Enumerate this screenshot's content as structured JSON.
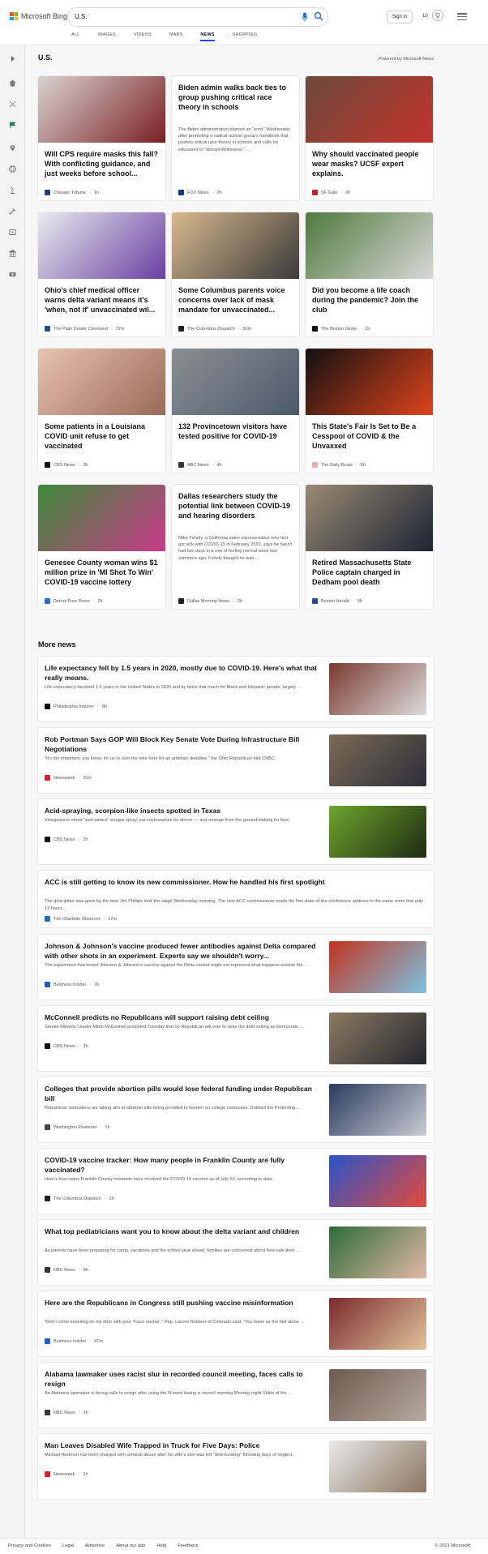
{
  "header": {
    "logo_text": "Microsoft Bing",
    "search_value": "U.S.",
    "tabs": [
      "ALL",
      "IMAGES",
      "VIDEOS",
      "MAPS",
      "NEWS",
      "SHOPPING"
    ],
    "active_tab": "NEWS",
    "signin_label": "Sign in",
    "reward_count": "10"
  },
  "section": {
    "title": "U.S.",
    "powered_by": "Powered by Microsoft News"
  },
  "cards": [
    {
      "title": "Will CPS require masks this fall? With conflicting guidance, and just weeks before school...",
      "source": "Chicago Tribune",
      "time": "1h",
      "favicon_color": "#1b3f8f",
      "img_colors": [
        "#d9d4cf",
        "#7a1f24"
      ]
    },
    {
      "title": "Biden admin walks back ties to group pushing critical race theory in schools",
      "excerpt": "The Biden administration blamed an \"error\" Wednesday after promoting a radical activist group's handbook that pushes critical race theory in schools and calls on educators to \"disrupt Whiteness.\" ...",
      "source": "FOX News",
      "time": "2h",
      "favicon_color": "#0d3b80"
    },
    {
      "title": "Why should vaccinated people wear masks? UCSF expert explains.",
      "source": "SF Gate",
      "time": "6h",
      "favicon_color": "#d11f2a",
      "img_colors": [
        "#6b4a3a",
        "#c4322c"
      ]
    },
    {
      "title": "Ohio's chief medical officer warns delta variant means it's 'when, not if' unvaccinated wil...",
      "source": "The Plain Dealer Cleveland",
      "time": "37m",
      "favicon_color": "#1d4f91",
      "img_colors": [
        "#e8ecef",
        "#6a3fa0"
      ]
    },
    {
      "title": "Some Columbus parents voice concerns over lack of mask mandate for unvaccinated...",
      "source": "The Columbus Dispatch",
      "time": "56m",
      "favicon_color": "#222222",
      "img_colors": [
        "#d9b98e",
        "#3a3a3a"
      ]
    },
    {
      "title": "Did you become a life coach during the pandemic? Join the club",
      "source": "The Boston Globe",
      "time": "1h",
      "favicon_color": "#111111",
      "img_colors": [
        "#4f7a3b",
        "#d8d8d8"
      ]
    },
    {
      "title": "Some patients in a Louisiana COVID unit refuse to get vaccinated",
      "source": "CBS News",
      "time": "3h",
      "favicon_color": "#111111",
      "img_colors": [
        "#e7c3b0",
        "#9b6a55"
      ]
    },
    {
      "title": "132 Provincetown visitors have tested positive for COVID-19",
      "source": "ABC News",
      "time": "4h",
      "favicon_color": "#333333",
      "img_colors": [
        "#8b8f93",
        "#4c5a6b"
      ]
    },
    {
      "title": "This State's Fair Is Set to Be a Cesspool of COVID & the Unvaxxed",
      "source": "The Daily Beast",
      "time": "8h",
      "favicon_color": "#f3a9a9",
      "img_colors": [
        "#111111",
        "#e0431c"
      ]
    },
    {
      "title": "Genesee County woman wins $1 million prize in 'MI Shot To Win' COVID-19 vaccine lottery",
      "source": "Detroit Free Press",
      "time": "2h",
      "favicon_color": "#1e6fd0",
      "img_colors": [
        "#3c8a3a",
        "#c93a8a"
      ]
    },
    {
      "title": "Dallas researchers study the potential link between COVID-19 and hearing disorders",
      "excerpt": "Mike Fehely, a California sales representative who first got sick with COVID-19 in February 2020, says he hasn't had two days in a row of feeling normal since two summers ago. Fehely thought he was ...",
      "source": "Dallas Morning News",
      "time": "2h",
      "favicon_color": "#222222"
    },
    {
      "title": "Retired Massachusetts State Police captain charged in Dedham pool death",
      "source": "Boston Herald",
      "time": "3h",
      "favicon_color": "#1c4da1",
      "img_colors": [
        "#9a8a74",
        "#1d2433"
      ]
    }
  ],
  "more_news": {
    "title": "More news",
    "items": [
      {
        "title": "Life expectancy fell by 1.5 years in 2020, mostly due to COVID-19. Here's what that really means.",
        "snippet": "Life expectancy declined 1.5 years in the United States in 2020 and by twice that much for Black and Hispanic people, largely ...",
        "source": "Philadelphia Inquirer",
        "time": "8h",
        "favicon_color": "#111111",
        "img_colors": [
          "#7a3a30",
          "#dcdcdc"
        ]
      },
      {
        "title": "Rob Portman Says GOP Will Block Key Senate Vote During Infrastructure Bill Negotiations",
        "snippet": "\"It's too important, you know, for us to rush the vote here for an arbitrary deadline,\" the Ohio Republican told CNBC.",
        "source": "Newsweek",
        "time": "31m",
        "favicon_color": "#e01b22",
        "img_colors": [
          "#7b6a55",
          "#2d2f3a"
        ]
      },
      {
        "title": "Acid-spraying, scorpion-like insects spotted in Texas",
        "snippet": "Vinegaroons shoot \"well-aimed\" vinegar spray, eat cockroaches for dinner — and emerge from the ground looking for love.",
        "source": "CBS News",
        "time": "2h",
        "favicon_color": "#111111",
        "img_colors": [
          "#6ea52e",
          "#1e2a12"
        ]
      },
      {
        "title": "ACC is still getting to know its new commissioner. How he handled his first spotlight",
        "snippet": "The gold glitter was gone by the time Jim Phillips took the stage Wednesday morning. The new ACC commissioner made his first state-of-the-conference address in the same room that only 12 hours ...",
        "source": "The Charlotte Observer",
        "time": "27m",
        "favicon_color": "#1f6fc5"
      },
      {
        "title": "Johnson & Johnson's vaccine produced fewer antibodies against Delta compared with other shots in an experiment. Experts say we shouldn't worry...",
        "snippet": "The experiment that tested Johnson & Johnson's vaccine against the Delta variant might not represent what happens outside the ...",
        "source": "Business Insider",
        "time": "3h",
        "favicon_color": "#1e5bd6",
        "img_colors": [
          "#c0341f",
          "#7ec2e0"
        ]
      },
      {
        "title": "McConnell predicts no Republicans will support raising debt ceiling",
        "snippet": "Senate Minority Leader Mitch McConnell predicted Tuesday that no Republican will vote to raise the debt ceiling as Democrats ...",
        "source": "CBS News",
        "time": "3h",
        "favicon_color": "#111111",
        "img_colors": [
          "#8b7a62",
          "#25272e"
        ]
      },
      {
        "title": "Colleges that provide abortion pills would lose federal funding under Republican bill",
        "snippet": "Republican lawmakers are taking aim at abortion pills being provided to women on college campuses. Dubbed the Protecting ...",
        "source": "Washington Examiner",
        "time": "1h",
        "favicon_color": "#444444",
        "img_colors": [
          "#2a3b5e",
          "#c9ccd4"
        ]
      },
      {
        "title": "COVID-19 vaccine tracker: How many people in Franklin County are fully vaccinated?",
        "snippet": "Here's how many Franklin County residents have received the COVID-19 vaccine as of July 20, according to data.",
        "source": "The Columbus Dispatch",
        "time": "3h",
        "favicon_color": "#222222",
        "img_colors": [
          "#2a55c9",
          "#e34a3a"
        ]
      },
      {
        "title": "What top pediatricians want you to know about the delta variant and children",
        "snippet": "As parents have been preparing for camp, vacations and the school year ahead, families are concerned about how safe their ...",
        "source": "NBC News",
        "time": "9h",
        "favicon_color": "#333333",
        "img_colors": [
          "#2e6b3c",
          "#e2b9a3"
        ]
      },
      {
        "title": "Here are the Republicans in Congress still pushing vaccine misinformation",
        "snippet": "\"Don't come knocking on my door with your 'Fauci ouchie',\" Rep. Lauren Boebert of Colorado said. \"You leave us the hell alone ...",
        "source": "Business Insider",
        "time": "47m",
        "favicon_color": "#1e5bd6",
        "img_colors": [
          "#7a2b2e",
          "#e0c39a"
        ]
      },
      {
        "title": "Alabama lawmaker uses racist slur in recorded council meeting, faces calls to resign",
        "snippet": "An Alabama lawmaker is facing calls to resign after using the N-word during a council meeting Monday night.Video of the ...",
        "source": "NBC News",
        "time": "1h",
        "favicon_color": "#333333",
        "img_colors": [
          "#6e5a4f",
          "#b7aaa0"
        ]
      },
      {
        "title": "Man Leaves Disabled Wife Trapped in Truck for Five Days: Police",
        "snippet": "Michael Redmon has been charged with criminal abuse after his wife's skin was left \"deteriorating\" following days of neglect.",
        "source": "Newsweek",
        "time": "1h",
        "favicon_color": "#e01b22",
        "img_colors": [
          "#e9e9e9",
          "#8a7560"
        ]
      }
    ]
  },
  "footer": {
    "links": [
      "Privacy and Cookies",
      "Legal",
      "Advertise",
      "About our ads",
      "Help",
      "Feedback"
    ],
    "copyright": "© 2021 Microsoft"
  }
}
